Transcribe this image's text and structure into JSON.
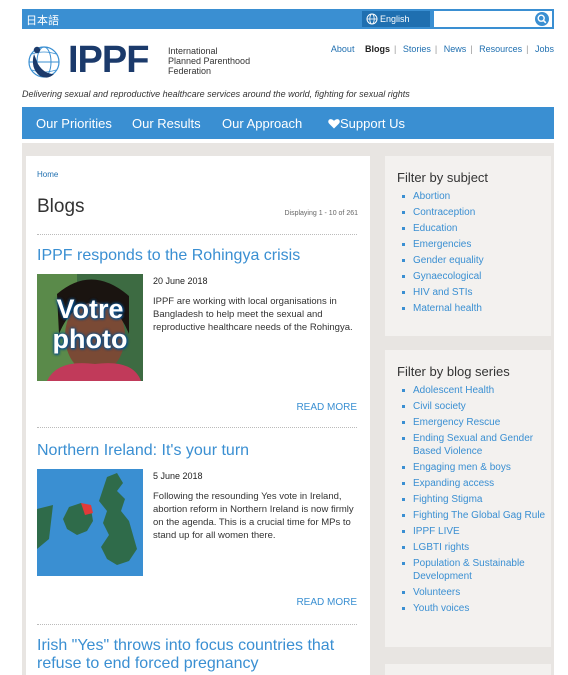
{
  "topbar": {
    "language_link": "日本語",
    "english_button": "English",
    "search_placeholder": ""
  },
  "logo": {
    "wordmark": "IPPF",
    "line1": "International",
    "line2": "Planned Parenthood",
    "line3": "Federation"
  },
  "topnav": {
    "items": [
      "About",
      "Blogs",
      "Stories",
      "News",
      "Resources",
      "Jobs"
    ],
    "active": "Blogs"
  },
  "tagline": "Delivering sexual and reproductive healthcare services around the world, fighting for sexual rights",
  "mainnav": {
    "items": [
      "Our Priorities",
      "Our Results",
      "Our Approach",
      "Support Us"
    ]
  },
  "breadcrumb": "Home",
  "page_title": "Blogs",
  "displaying": "Displaying 1 - 10 of 261",
  "posts": [
    {
      "title": "IPPF responds to the Rohingya crisis",
      "date": "20 June 2018",
      "excerpt": "IPPF are working with local organisations in Bangladesh to help meet the sexual and reproductive healthcare needs of the Rohingya.",
      "image_overlay_line1": "Votre",
      "image_overlay_line2": "photo",
      "read_more": "READ MORE"
    },
    {
      "title": "Northern Ireland: It's your turn",
      "date": "5 June 2018",
      "excerpt": "Following the resounding Yes vote in Ireland, abortion reform in Northern Ireland is now firmly on the agenda. This is a crucial time for MPs to stand up for all women there.",
      "read_more": "READ MORE"
    },
    {
      "title": "Irish \"Yes\" throws into focus countries that refuse to end forced pregnancy"
    }
  ],
  "filter_subject": {
    "heading": "Filter by subject",
    "items": [
      "Abortion",
      "Contraception",
      "Education",
      "Emergencies",
      "Gender equality",
      "Gynaecological",
      "HIV and STIs",
      "Maternal health"
    ]
  },
  "filter_series": {
    "heading": "Filter by blog series",
    "items": [
      "Adolescent Health",
      "Civil society",
      "Emergency Rescue",
      "Ending Sexual and Gender Based Violence",
      "Engaging men & boys",
      "Expanding access",
      "Fighting Stigma",
      "Fighting The Global Gag Rule",
      "IPPF LIVE",
      "LGBTI rights",
      "Population & Sustainable Development",
      "Volunteers",
      "Youth voices"
    ]
  },
  "colors": {
    "brand_blue": "#3a8fd2",
    "dark_blue": "#1f6fb0",
    "logo_navy": "#1b3a6b",
    "page_grey": "#e8e5e2"
  },
  "icons": {
    "globe": "globe-icon",
    "search": "search-icon",
    "heart": "heart-icon"
  }
}
